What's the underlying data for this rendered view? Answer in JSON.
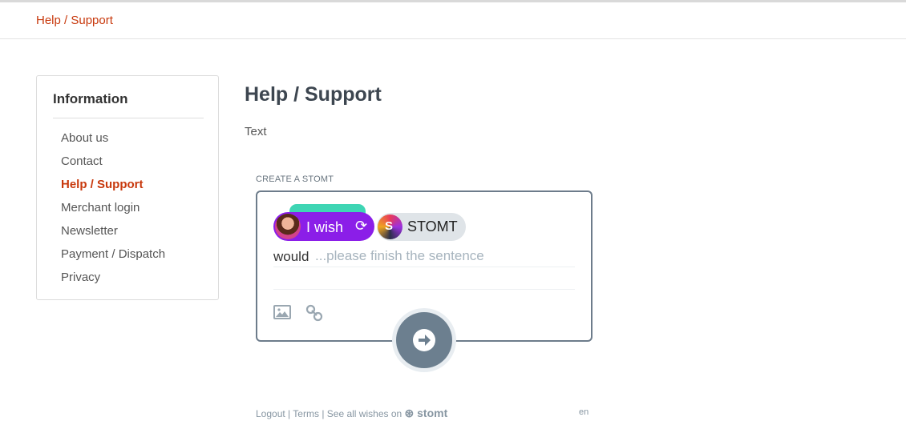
{
  "breadcrumb": "Help / Support",
  "sidebar": {
    "title": "Information",
    "items": [
      {
        "label": "About us"
      },
      {
        "label": "Contact"
      },
      {
        "label": "Help / Support",
        "active": true
      },
      {
        "label": "Merchant login"
      },
      {
        "label": "Newsletter"
      },
      {
        "label": "Payment / Dispatch"
      },
      {
        "label": "Privacy"
      }
    ]
  },
  "main": {
    "title": "Help / Support",
    "text": "Text"
  },
  "widget": {
    "label": "CREATE A STOMT",
    "wish_label": "I wish",
    "target_name": "STOMT",
    "would": "would",
    "placeholder": "...please finish the sentence"
  },
  "footer": {
    "logout": "Logout",
    "terms": "Terms",
    "see_all": "See all wishes on",
    "brand": "stomt",
    "lang": "en"
  },
  "colors": {
    "accent": "#c8390d",
    "wish_purple": "#8b1ee8",
    "teal": "#3ed5b4",
    "widget_border": "#6d7c8b"
  }
}
